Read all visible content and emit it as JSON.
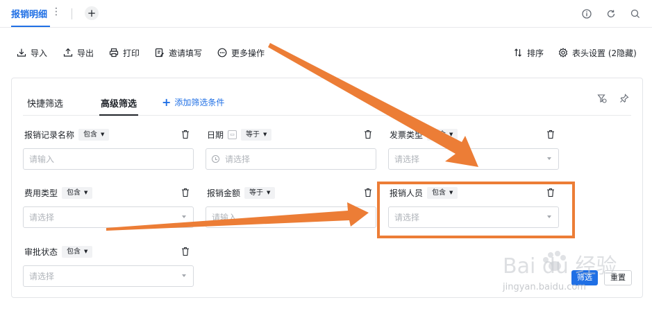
{
  "tabbar": {
    "active_tab": "报销明细",
    "more_glyph": "⋮",
    "add_glyph": "+",
    "icons": [
      "info-icon",
      "refresh-icon",
      "search-icon"
    ]
  },
  "toolbar": {
    "import_label": "导入",
    "export_label": "导出",
    "print_label": "打印",
    "invite_label": "邀请填写",
    "more_label": "更多操作",
    "sort_label": "排序",
    "header_settings_label": "表头设置 (2隐藏)"
  },
  "filter_panel": {
    "tabs": [
      {
        "label": "快捷筛选",
        "active": false
      },
      {
        "label": "高级筛选",
        "active": true
      }
    ],
    "add_condition_label": "添加筛选条件",
    "fields": [
      {
        "label": "报销记录名称",
        "operator": "包含",
        "placeholder": "请输入",
        "kind": "text"
      },
      {
        "label": "日期",
        "operator": "等于",
        "placeholder": "请选择",
        "kind": "date"
      },
      {
        "label": "发票类型",
        "operator": "包含",
        "placeholder": "请选择",
        "kind": "select"
      },
      {
        "label": "费用类型",
        "operator": "包含",
        "placeholder": "请选择",
        "kind": "select"
      },
      {
        "label": "报销金额",
        "operator": "等于",
        "placeholder": "请输入",
        "kind": "text"
      },
      {
        "label": "报销人员",
        "operator": "包含",
        "placeholder": "请选择",
        "kind": "select",
        "highlighted": true
      },
      {
        "label": "审批状态",
        "operator": "包含",
        "placeholder": "请选择",
        "kind": "select"
      }
    ],
    "filter_button_label": "筛选",
    "reset_button_label": "重置"
  },
  "annotation": {
    "color": "#ec7d36"
  },
  "colors": {
    "primary": "#1f6fe5",
    "text": "#1f2329",
    "placeholder": "#b0b4ba",
    "border": "#d6d9de"
  },
  "watermark": {
    "brand": "Bai du 经验",
    "url": "jingyan.baidu.com"
  }
}
